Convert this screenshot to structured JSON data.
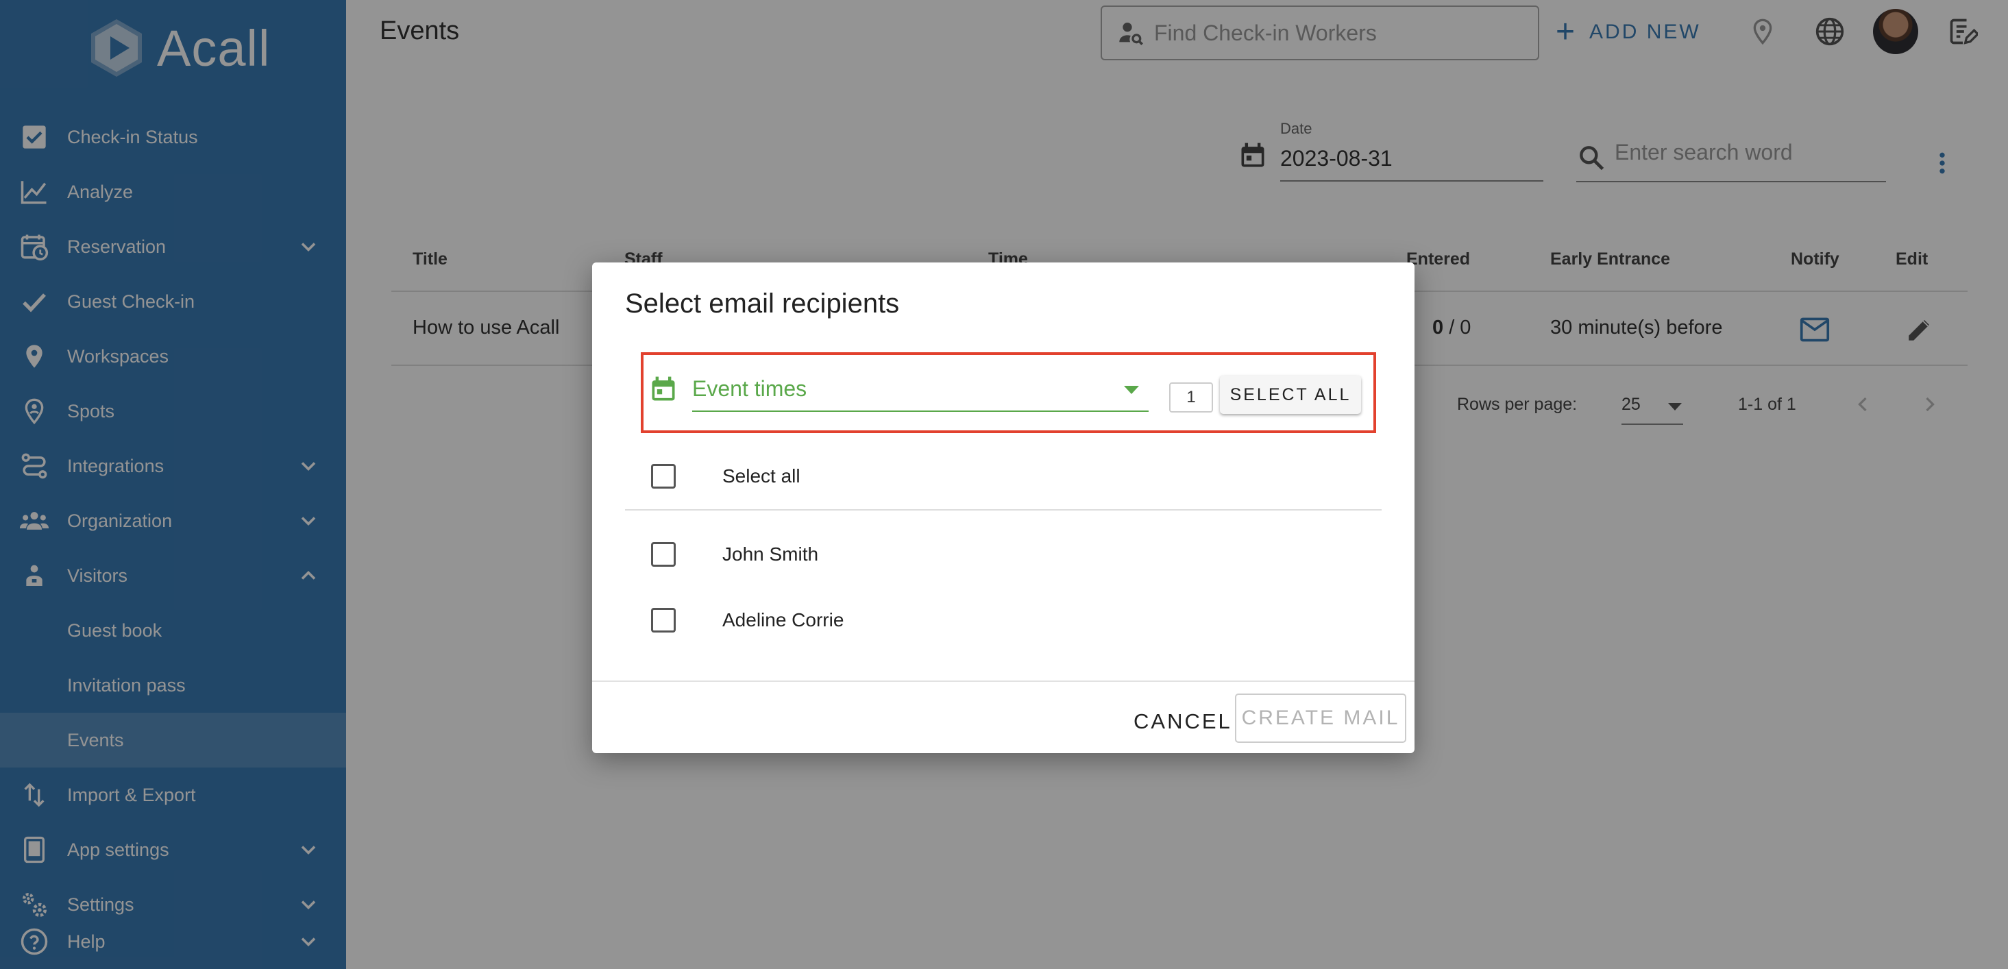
{
  "app": {
    "name": "Acall"
  },
  "sidebar": {
    "items": [
      {
        "label": "Check-in Status",
        "icon": "checkbox-icon"
      },
      {
        "label": "Analyze",
        "icon": "chart-line-icon"
      },
      {
        "label": "Reservation",
        "icon": "calendar-clock-icon",
        "expand": "down"
      },
      {
        "label": "Guest Check-in",
        "icon": "check-icon"
      },
      {
        "label": "Workspaces",
        "icon": "map-pin-icon"
      },
      {
        "label": "Spots",
        "icon": "person-pin-icon"
      },
      {
        "label": "Integrations",
        "icon": "integrations-icon",
        "expand": "down"
      },
      {
        "label": "Organization",
        "icon": "people-icon",
        "expand": "down"
      },
      {
        "label": "Visitors",
        "icon": "visitor-icon",
        "expand": "up"
      },
      {
        "label": "Guest book"
      },
      {
        "label": "Invitation pass"
      },
      {
        "label": "Events",
        "active": true
      },
      {
        "label": "Import & Export",
        "icon": "import-export-icon"
      },
      {
        "label": "App settings",
        "icon": "tablet-icon",
        "expand": "down"
      },
      {
        "label": "Settings",
        "icon": "settings-icon",
        "expand": "down"
      },
      {
        "label": "Help",
        "icon": "help-icon",
        "expand": "down"
      }
    ]
  },
  "header": {
    "title": "Events",
    "search_placeholder": "Find Check-in Workers",
    "add_new_label": "ADD NEW"
  },
  "filters": {
    "date_label": "Date",
    "date_value": "2023-08-31",
    "search_placeholder": "Enter search word"
  },
  "table": {
    "columns": [
      "Title",
      "Staff",
      "Time",
      "Entered",
      "Early Entrance",
      "Notify",
      "Edit"
    ],
    "rows": [
      {
        "title": "How to use Acall",
        "entered_bold": "0",
        "entered_total": " / 0",
        "early_entrance": "30 minute(s) before"
      }
    ],
    "rows_per_page_label": "Rows per page:",
    "rows_per_page_value": "25",
    "range_text": "1-1 of 1"
  },
  "dialog": {
    "title": "Select email recipients",
    "event_select_value": "Event times",
    "count_value": "1",
    "select_all_button": "SELECT ALL",
    "select_all_checkbox": "Select all",
    "recipients": [
      "John Smith",
      "Adeline Corrie"
    ],
    "cancel_label": "CANCEL",
    "create_label": "CREATE MAIL"
  },
  "colors": {
    "sidebar": "#3a7ab3",
    "accent_green": "#5aa84a",
    "highlight_red": "#e2412e"
  }
}
